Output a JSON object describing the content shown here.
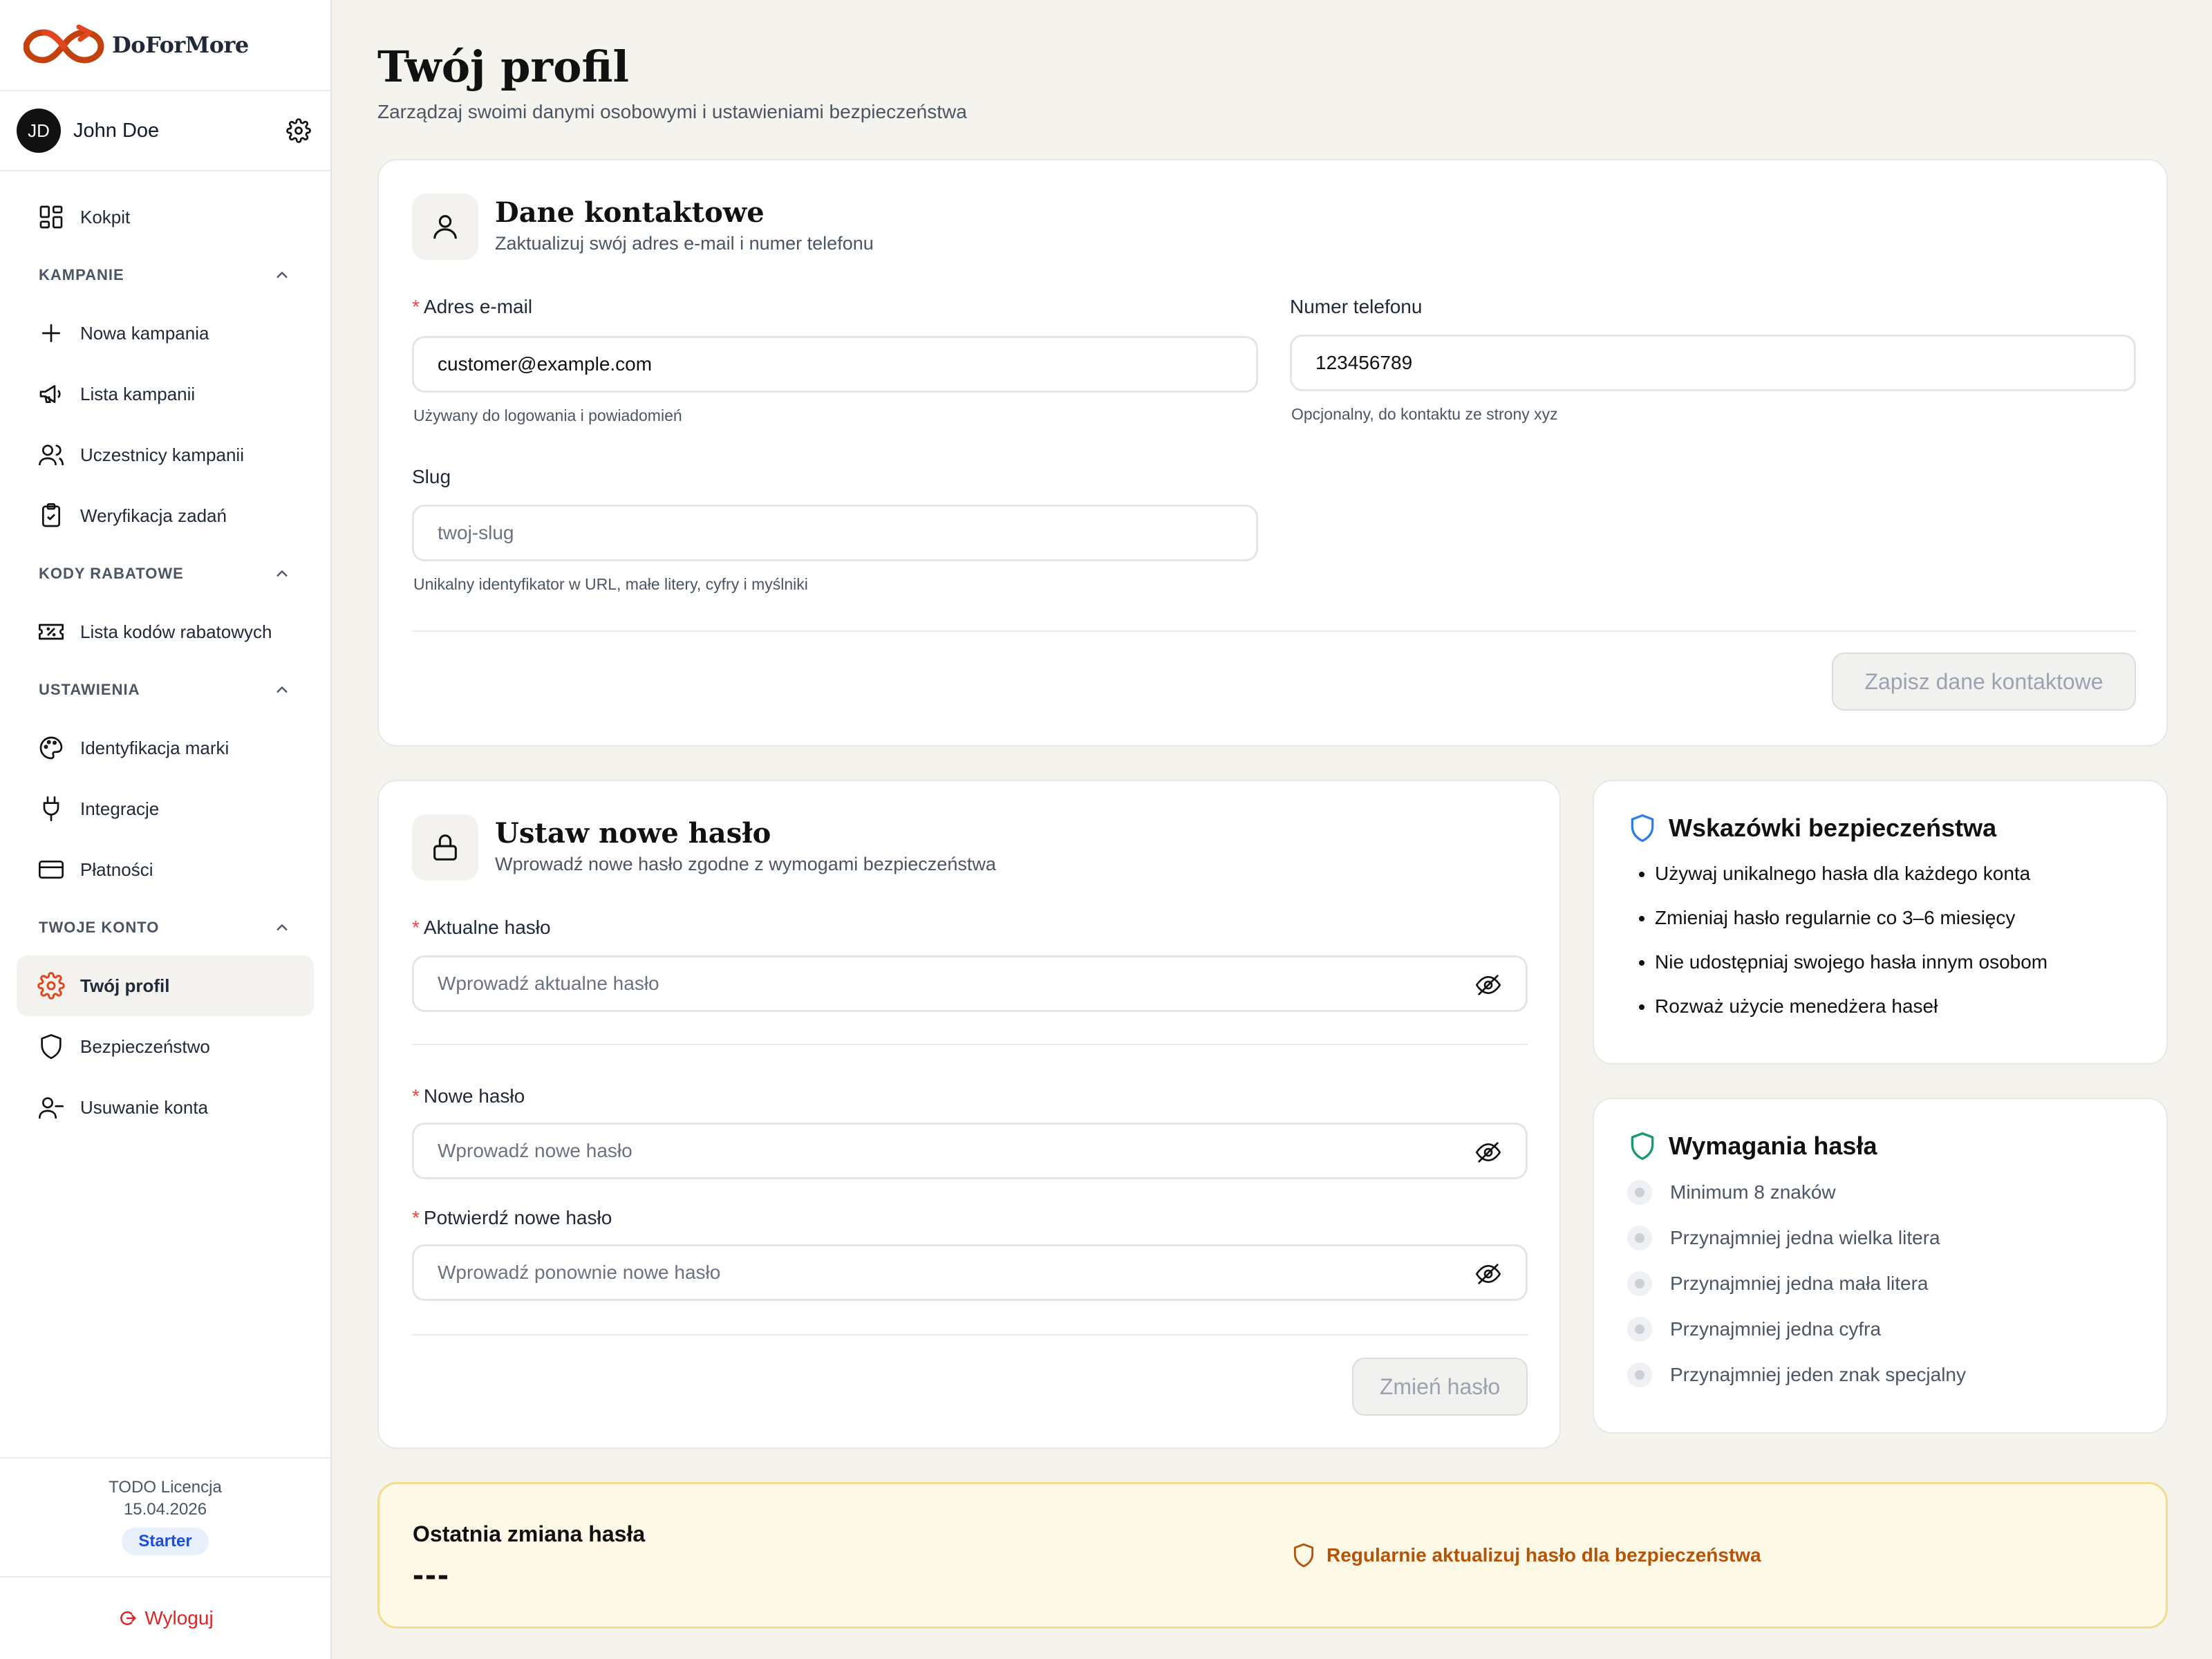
{
  "brand": {
    "name": "DoForMore",
    "accent": "#e2461f"
  },
  "user": {
    "initials": "JD",
    "name": "John Doe"
  },
  "nav": {
    "dashboard": "Kokpit",
    "sections": {
      "campaigns": "KAMPANIE",
      "discount": "KODY RABATOWE",
      "settings": "USTAWIENIA",
      "account": "TWOJE KONTO"
    },
    "items": {
      "new_campaign": "Nowa kampania",
      "campaign_list": "Lista kampanii",
      "participants": "Uczestnicy kampanii",
      "task_verification": "Weryfikacja zadań",
      "discount_list": "Lista kodów rabatowych",
      "brand_identity": "Identyfikacja marki",
      "integrations": "Integracje",
      "payments": "Płatności",
      "profile": "Twój profil",
      "security": "Bezpieczeństwo",
      "delete_account": "Usuwanie konta"
    }
  },
  "license": {
    "text": "TODO Licencja",
    "date": "15.04.2026",
    "plan": "Starter"
  },
  "logout": "Wyloguj",
  "page": {
    "title": "Twój profil",
    "subtitle": "Zarządzaj swoimi danymi osobowymi i ustawieniami bezpieczeństwa"
  },
  "contact": {
    "title": "Dane kontaktowe",
    "subtitle": "Zaktualizuj swój adres e-mail i numer telefonu",
    "email_label": "Adres e-mail",
    "email_value": "customer@example.com",
    "email_hint": "Używany do logowania i powiadomień",
    "phone_label": "Numer telefonu",
    "phone_value": "123456789",
    "phone_hint": "Opcjonalny, do kontaktu ze strony xyz",
    "slug_label": "Slug",
    "slug_placeholder": "twoj-slug",
    "slug_hint": "Unikalny identyfikator w URL, małe litery, cyfry i myślniki",
    "save": "Zapisz dane kontaktowe"
  },
  "password": {
    "title": "Ustaw nowe hasło",
    "subtitle": "Wprowadź nowe hasło zgodne z wymogami bezpieczeństwa",
    "current_label": "Aktualne hasło",
    "current_placeholder": "Wprowadź aktualne hasło",
    "new_label": "Nowe hasło",
    "new_placeholder": "Wprowadź nowe hasło",
    "confirm_label": "Potwierdź nowe hasło",
    "confirm_placeholder": "Wprowadź ponownie nowe hasło",
    "submit": "Zmień hasło"
  },
  "tips": {
    "title": "Wskazówki bezpieczeństwa",
    "items": [
      "Używaj unikalnego hasła dla każdego konta",
      "Zmieniaj hasło regularnie co 3–6 miesięcy",
      "Nie udostępniaj swojego hasła innym osobom",
      "Rozważ użycie menedżera haseł"
    ]
  },
  "requirements": {
    "title": "Wymagania hasła",
    "items": [
      "Minimum 8 znaków",
      "Przynajmniej jedna wielka litera",
      "Przynajmniej jedna mała litera",
      "Przynajmniej jedna cyfra",
      "Przynajmniej jeden znak specjalny"
    ]
  },
  "last_change": {
    "title": "Ostatnia zmiana hasła",
    "value": "---",
    "reminder": "Regularnie aktualizuj hasło dla bezpieczeństwa"
  }
}
